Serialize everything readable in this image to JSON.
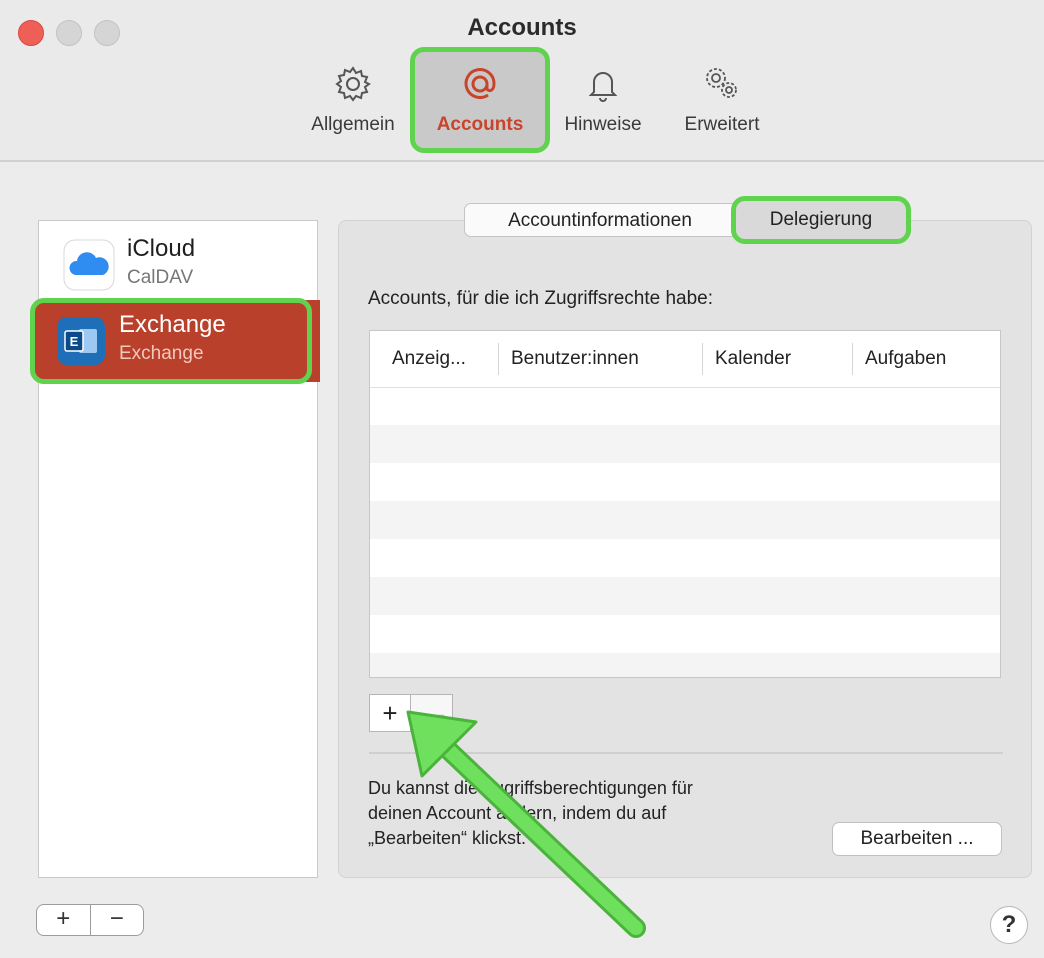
{
  "window": {
    "title": "Accounts"
  },
  "toolbar": {
    "items": [
      {
        "label": "Allgemein",
        "icon": "gear-icon"
      },
      {
        "label": "Accounts",
        "icon": "at-icon",
        "selected": true
      },
      {
        "label": "Hinweise",
        "icon": "bell-icon"
      },
      {
        "label": "Erweitert",
        "icon": "gears-icon"
      }
    ]
  },
  "sidebar": {
    "accounts": [
      {
        "name": "iCloud",
        "type": "CalDAV",
        "icon": "icloud-icon"
      },
      {
        "name": "Exchange",
        "type": "Exchange",
        "icon": "exchange-icon",
        "selected": true
      }
    ],
    "add_label": "+",
    "remove_label": "−"
  },
  "tabs": {
    "info": "Accountinformationen",
    "delegation": "Delegierung",
    "active": "Delegierung"
  },
  "delegation": {
    "heading": "Accounts, für die ich Zugriffsrechte habe:",
    "columns": [
      "Anzeig...",
      "Benutzer:innen",
      "Kalender",
      "Aufgaben"
    ],
    "add_label": "+",
    "remove_label": "—",
    "note_lines": [
      "Du kannst die Zugriffsberechtigungen für",
      "deinen Account ändern, indem du auf",
      "„Bearbeiten“ klickst."
    ],
    "edit_button": "Bearbeiten ..."
  },
  "help_label": "?",
  "colors": {
    "accent": "#c8452c",
    "selection": "#b9412b",
    "highlight": "#5fd34e"
  }
}
